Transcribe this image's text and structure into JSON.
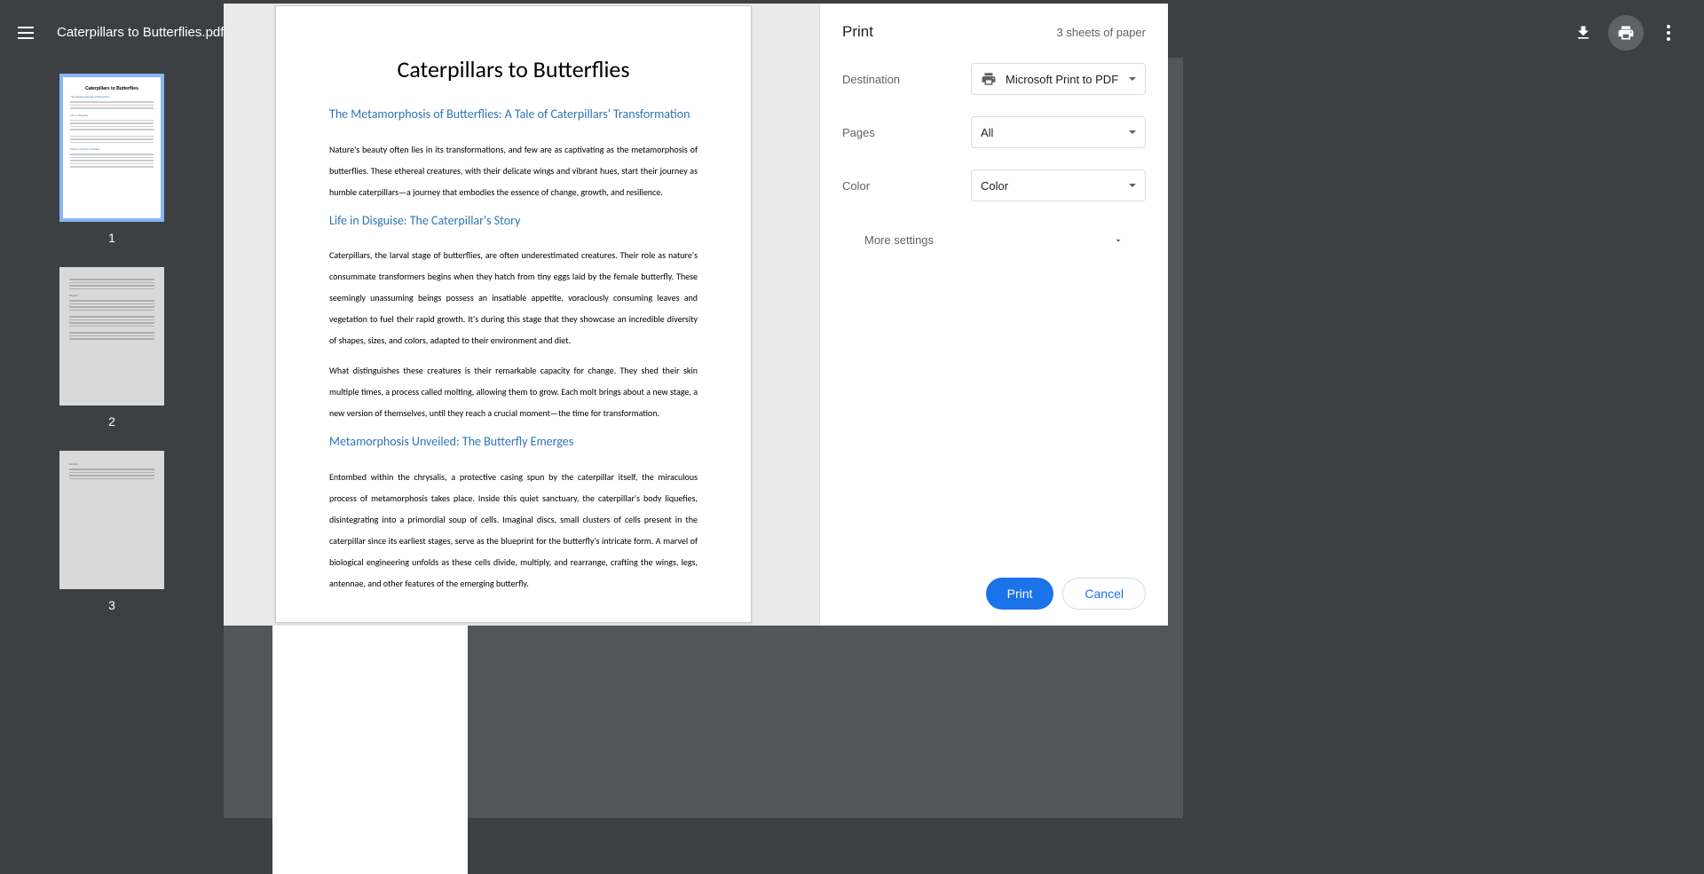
{
  "header": {
    "file_name": "Caterpillars to Butterflies.pdf"
  },
  "thumbnails": {
    "pages": [
      "1",
      "2",
      "3"
    ]
  },
  "preview": {
    "title": "Caterpillars to Butterflies",
    "heading1": "The Metamorphosis of Butterflies: A Tale of Caterpillars' Transformation",
    "para1": "Nature's beauty often lies in its transformations, and few are as captivating as the metamorphosis of butterflies. These ethereal creatures, with their delicate wings and vibrant hues, start their journey as humble caterpillars—a journey that embodies the essence of change, growth, and resilience.",
    "heading2": "Life in Disguise: The Caterpillar's Story",
    "para2": "Caterpillars, the larval stage of butterflies, are often underestimated creatures. Their role as nature's consummate transformers begins when they hatch from tiny eggs laid by the female butterfly. These seemingly unassuming beings possess an insatiable appetite, voraciously consuming leaves and vegetation to fuel their rapid growth. It's during this stage that they showcase an incredible diversity of shapes, sizes, and colors, adapted to their environment and diet.",
    "para3": "What distinguishes these creatures is their remarkable capacity for change. They shed their skin multiple times, a process called molting, allowing them to grow. Each molt brings about a new stage, a new version of themselves, until they reach a crucial moment—the time for transformation.",
    "heading3": "Metamorphosis Unveiled: The Butterfly Emerges",
    "para4": "Entombed within the chrysalis, a protective casing spun by the caterpillar itself, the miraculous process of metamorphosis takes place. Inside this quiet sanctuary, the caterpillar's body liquefies, disintegrating into a primordial soup of cells. Imaginal discs, small clusters of cells present in the caterpillar since its earliest stages, serve as the blueprint for the butterfly's intricate form. A marvel of biological engineering unfolds as these cells divide, multiply, and rearrange, crafting the wings, legs, antennae, and other features of the emerging butterfly."
  },
  "print_panel": {
    "title": "Print",
    "sheet_info": "3 sheets of paper",
    "destination_label": "Destination",
    "destination_value": "Microsoft Print to PDF",
    "pages_label": "Pages",
    "pages_value": "All",
    "color_label": "Color",
    "color_value": "Color",
    "more_settings": "More settings",
    "print_button": "Print",
    "cancel_button": "Cancel"
  }
}
